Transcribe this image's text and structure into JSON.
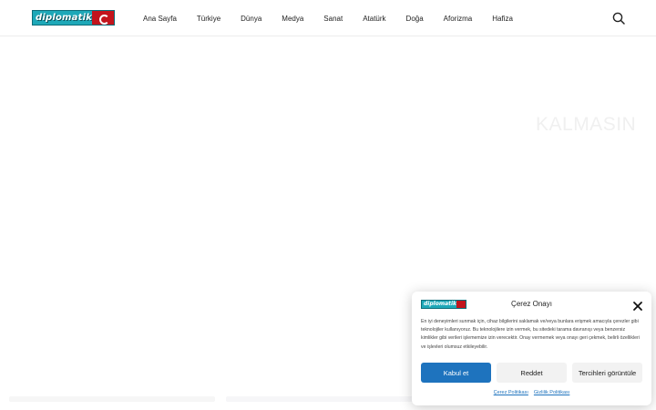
{
  "header": {
    "logo_text": "diplomatik",
    "nav": [
      "Ana Sayfa",
      "Türkiye",
      "Dünya",
      "Medya",
      "Sanat",
      "Atatürk",
      "Doğa",
      "Aforizma",
      "Hafiza"
    ],
    "search_icon": "search-icon"
  },
  "hero": {
    "faded_heading": "KALMASIN"
  },
  "cookie_banner": {
    "logo_text": "diplomatik",
    "title": "Çerez Onayı",
    "body": "En iyi deneyimleri sunmak için, cihaz bilgilerini saklamak ve/veya bunlara erişmek amacıyla çerezler gibi teknolojiler kullanıyoruz. Bu teknolojilere izin vermek, bu sitedeki tarama davranışı veya benzersiz kimlikler gibi verileri işlememize izin verecektir. Onay vermemek veya onayı geri çekmek, belirli özellikleri ve işlevleri olumsuz etkileyebilir.",
    "accept_label": "Kabul et",
    "deny_label": "Reddet",
    "prefs_label": "Tercihleri görüntüle",
    "links": [
      "Çerez Politikası",
      "Gizlilik Politikası"
    ],
    "accent_color": "#1e73be",
    "close_icon": "close-icon"
  }
}
